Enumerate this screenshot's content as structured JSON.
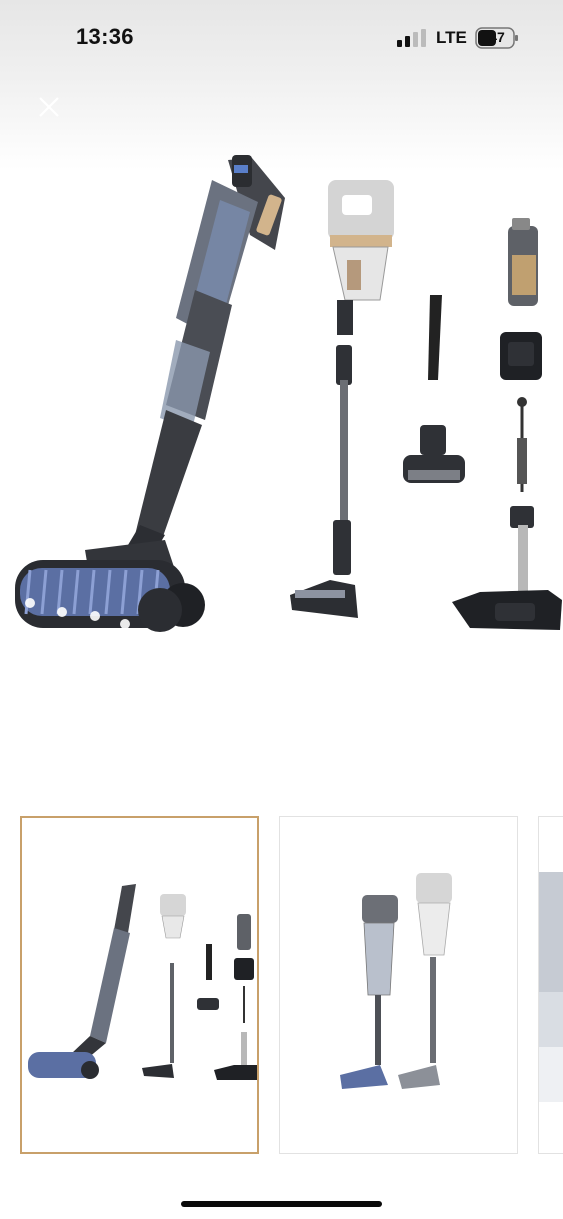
{
  "status_bar": {
    "time": "13:36",
    "network": "LTE",
    "battery": "47",
    "signal_icon": "signal-bars-icon"
  },
  "toolbar": {
    "close_icon": "close-icon"
  },
  "gallery": {
    "selected_index": 0,
    "thumbnails": [
      {
        "name": "thumbnail-1"
      },
      {
        "name": "thumbnail-2"
      },
      {
        "name": "thumbnail-3"
      }
    ]
  },
  "colors": {
    "selection_border": "#c8a06a",
    "vacuum_dark": "#3d3f44",
    "brush_blue": "#5b6fa3"
  }
}
